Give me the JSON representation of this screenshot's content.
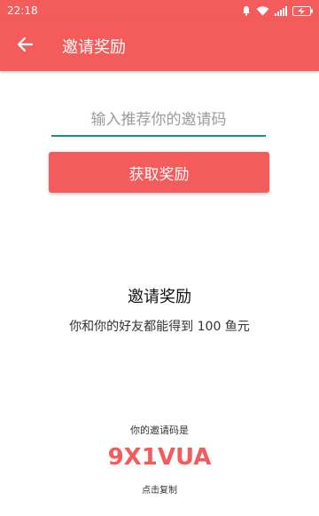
{
  "status_bar": {
    "time": "22:18",
    "icons": [
      "bell-icon",
      "wifi-icon",
      "signal-icon",
      "charging-battery-icon"
    ]
  },
  "app_bar": {
    "back_icon": "arrow-left-icon",
    "title": "邀请奖励"
  },
  "invite_form": {
    "input_value": "",
    "input_placeholder": "输入推荐你的邀请码",
    "submit_label": "获取奖励"
  },
  "reward_info": {
    "title": "邀请奖励",
    "description": "你和你的好友都能得到 100 鱼元"
  },
  "my_code": {
    "label": "你的邀请码是",
    "code": "9X1VUA",
    "copy_hint": "点击复制"
  },
  "colors": {
    "accent": "#f45b5b",
    "input_underline": "#1e8e80"
  }
}
